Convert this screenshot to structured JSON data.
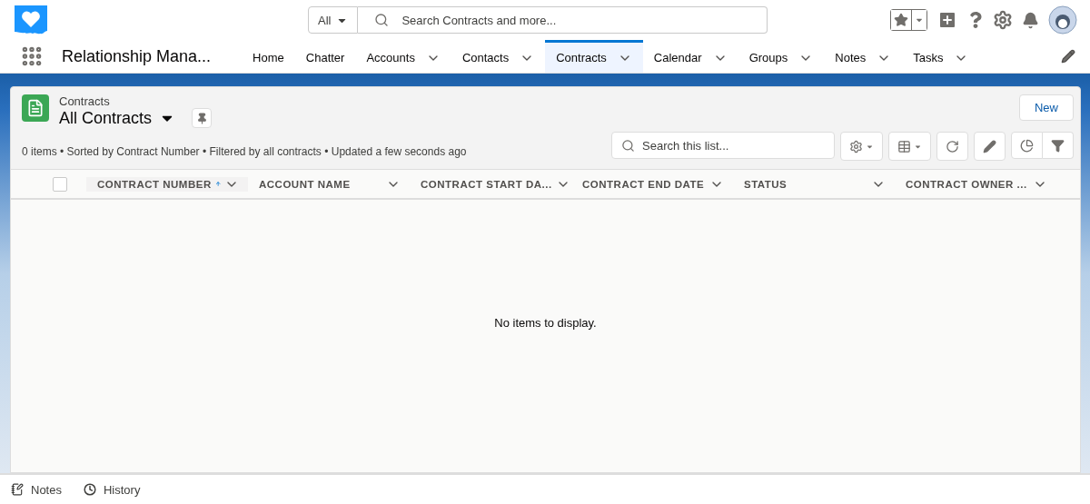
{
  "header": {
    "search": {
      "scope": "All",
      "placeholder": "Search Contracts and more..."
    }
  },
  "nav": {
    "app_name": "Relationship Mana...",
    "tabs": [
      {
        "label": "Home",
        "selected": false,
        "dropdown": false
      },
      {
        "label": "Chatter",
        "selected": false,
        "dropdown": false
      },
      {
        "label": "Accounts",
        "selected": false,
        "dropdown": true
      },
      {
        "label": "Contacts",
        "selected": false,
        "dropdown": true
      },
      {
        "label": "Contracts",
        "selected": true,
        "dropdown": true
      },
      {
        "label": "Calendar",
        "selected": false,
        "dropdown": true
      },
      {
        "label": "Groups",
        "selected": false,
        "dropdown": true
      },
      {
        "label": "Notes",
        "selected": false,
        "dropdown": true
      },
      {
        "label": "Tasks",
        "selected": false,
        "dropdown": true
      }
    ]
  },
  "list_view": {
    "object": "Contracts",
    "title": "All Contracts",
    "new_button": "New",
    "summary": "0 items • Sorted by Contract Number • Filtered by all contracts • Updated a few seconds ago",
    "search_placeholder": "Search this list...",
    "select_all_checked": false,
    "columns": [
      {
        "label": "CONTRACT NUMBER",
        "sorted": true
      },
      {
        "label": "ACCOUNT NAME",
        "sorted": false
      },
      {
        "label": "CONTRACT START DA...",
        "sorted": false
      },
      {
        "label": "CONTRACT END DATE",
        "sorted": false
      },
      {
        "label": "STATUS",
        "sorted": false
      },
      {
        "label": "CONTRACT OWNER ...",
        "sorted": false
      }
    ],
    "empty_message": "No items to display."
  },
  "footer": [
    {
      "label": "Notes",
      "kind": "notes"
    },
    {
      "label": "History",
      "kind": "history"
    }
  ]
}
